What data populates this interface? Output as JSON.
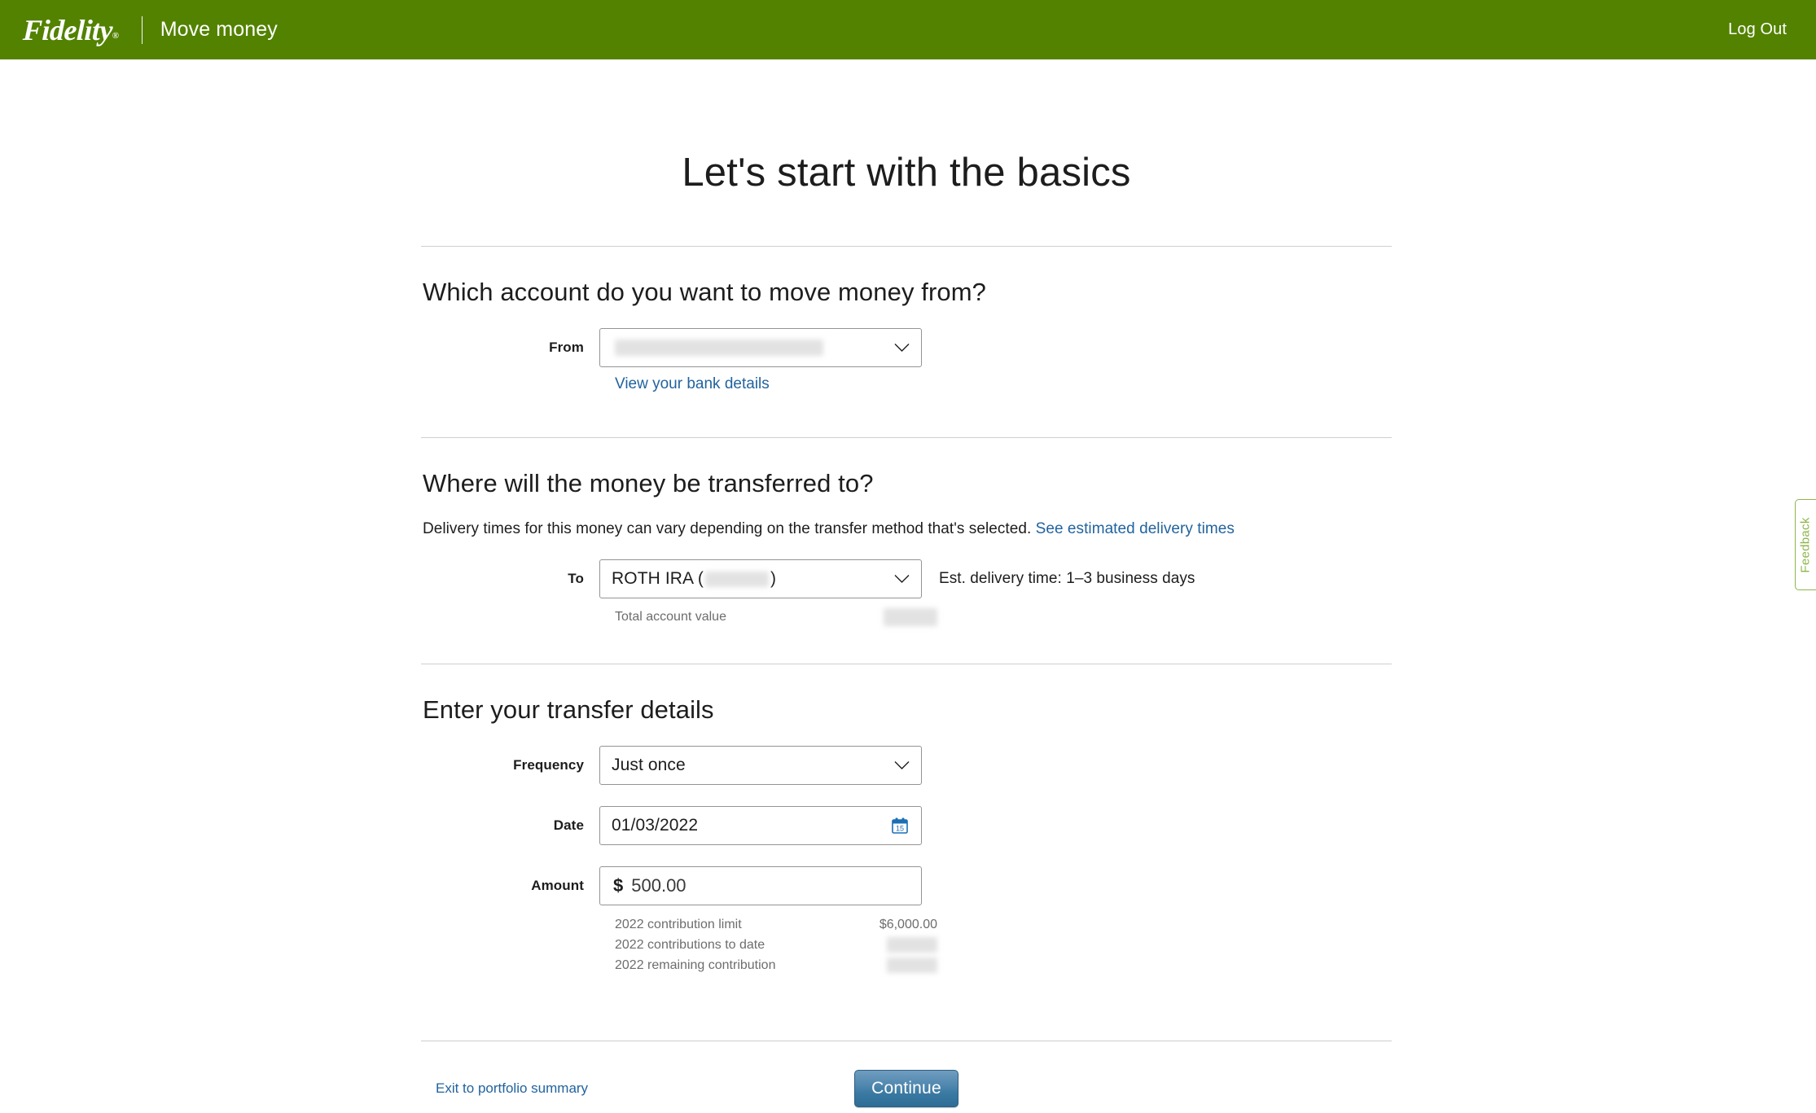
{
  "header": {
    "logo_text": "Fidelity",
    "registered_mark": "®",
    "app_title": "Move money",
    "logout_label": "Log Out",
    "background_color": "#528200"
  },
  "page": {
    "title": "Let's start with the basics"
  },
  "section_from": {
    "heading": "Which account do you want to move money from?",
    "field_label": "From",
    "selected_value": "",
    "value_redacted": true,
    "bank_details_link": "View your bank details"
  },
  "section_to": {
    "heading": "Where will the money be transferred to?",
    "note_text": "Delivery times for this money can vary depending on the transfer method that's selected.",
    "note_link": "See estimated delivery times",
    "field_label": "To",
    "selected_value_prefix": "ROTH IRA (",
    "selected_value_suffix": ")",
    "account_number_redacted": true,
    "delivery_estimate": "Est. delivery time: 1–3 business days",
    "total_label": "Total account value",
    "total_value": "",
    "total_value_redacted": true
  },
  "section_details": {
    "heading": "Enter your transfer details",
    "frequency": {
      "label": "Frequency",
      "value": "Just once"
    },
    "date": {
      "label": "Date",
      "value": "01/03/2022",
      "calendar_icon_day": "15"
    },
    "amount": {
      "label": "Amount",
      "currency_symbol": "$",
      "value": "500.00"
    },
    "contributions": [
      {
        "label": "2022 contribution limit",
        "value": "$6,000.00",
        "redacted": false
      },
      {
        "label": "2022 contributions to date",
        "value": "",
        "redacted": true
      },
      {
        "label": "2022 remaining contribution",
        "value": "",
        "redacted": true
      }
    ]
  },
  "footer": {
    "exit_link": "Exit to portfolio summary",
    "continue_label": "Continue",
    "continue_color": "#3b7aa3"
  },
  "feedback": {
    "label": "Feedback",
    "accent_color": "#8db54a"
  }
}
